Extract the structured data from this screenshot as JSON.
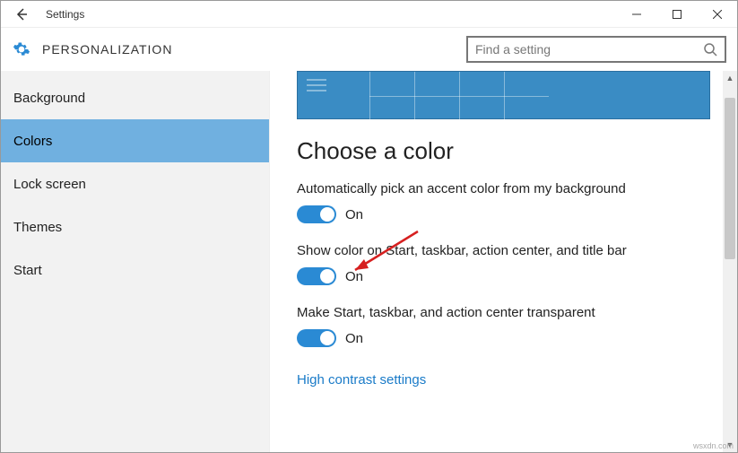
{
  "titlebar": {
    "title": "Settings"
  },
  "header": {
    "section": "PERSONALIZATION",
    "search_placeholder": "Find a setting"
  },
  "sidebar": {
    "items": [
      "Background",
      "Colors",
      "Lock screen",
      "Themes",
      "Start"
    ],
    "selected_index": 1
  },
  "content": {
    "heading": "Choose a color",
    "settings": [
      {
        "label": "Automatically pick an accent color from my background",
        "on": true,
        "state": "On"
      },
      {
        "label": "Show color on Start, taskbar, action center, and title bar",
        "on": true,
        "state": "On"
      },
      {
        "label": "Make Start, taskbar, and action center transparent",
        "on": true,
        "state": "On"
      }
    ],
    "link": "High contrast settings"
  },
  "watermark": "wsxdn.com"
}
